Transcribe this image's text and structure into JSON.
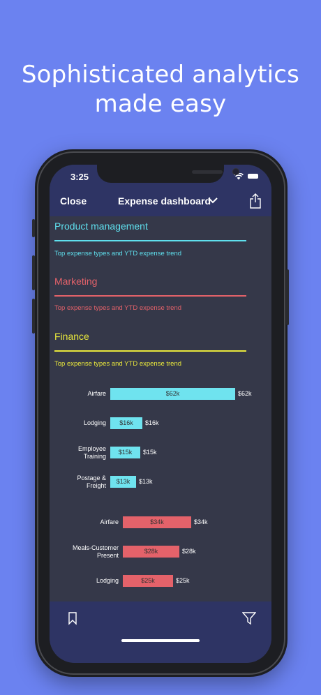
{
  "headline": {
    "line1": "Sophisticated analytics",
    "line2": "made easy"
  },
  "status": {
    "time": "3:25"
  },
  "nav": {
    "close_label": "Close",
    "title": "Expense dashboard"
  },
  "sections": [
    {
      "title": "Product management",
      "subtitle": "Top expense types and YTD expense trend",
      "color": "#5FE0EE"
    },
    {
      "title": "Marketing",
      "subtitle": "Top expense types and YTD expense trend",
      "color": "#E4626A"
    },
    {
      "title": "Finance",
      "subtitle": "Top expense types and YTD expense trend",
      "color": "#E9E83C"
    }
  ],
  "chart_data": {
    "type": "bar",
    "orientation": "horizontal",
    "series": [
      {
        "color": "#6FE3EF",
        "categories": [
          "Airfare",
          "Lodging",
          "Employee Training",
          "Postage & Freight"
        ],
        "category_lines": [
          [
            "Airfare"
          ],
          [
            "Lodging"
          ],
          [
            "Employee",
            "Training"
          ],
          [
            "Postage &",
            "Freight"
          ]
        ],
        "values": [
          62,
          16,
          15,
          13
        ],
        "labels": [
          "$62k",
          "$16k",
          "$15k",
          "$13k"
        ]
      },
      {
        "color": "#E4626A",
        "categories": [
          "Airfare",
          "Meals-Customer Present",
          "Lodging"
        ],
        "category_lines": [
          [
            "Airfare"
          ],
          [
            "Meals-Customer",
            "Present"
          ],
          [
            "Lodging"
          ]
        ],
        "values": [
          34,
          28,
          25
        ],
        "labels": [
          "$34k",
          "$28k",
          "$25k"
        ]
      }
    ]
  },
  "icons": {
    "bookmark": "bookmark-icon",
    "filter": "filter-icon",
    "share": "share-icon",
    "chevron": "chevron-down-icon"
  }
}
